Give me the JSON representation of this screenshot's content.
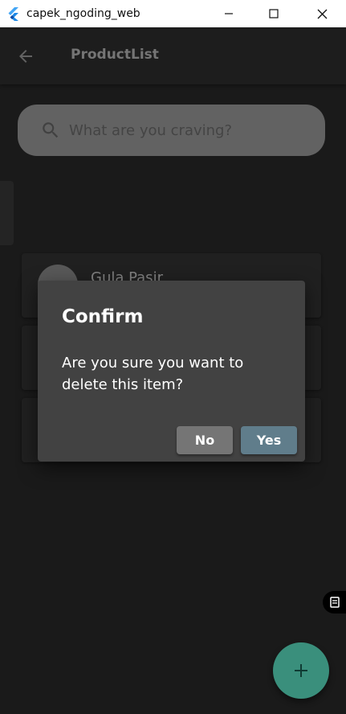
{
  "window": {
    "title": "capek_ngoding_web",
    "app_icon": "flutter-logo",
    "controls": [
      "minimize-icon",
      "maximize-icon",
      "close-icon"
    ]
  },
  "appbar": {
    "title": "ProductList",
    "back_icon": "arrow-back-icon"
  },
  "search": {
    "placeholder": "What are you craving?",
    "value": "",
    "icon": "search-icon"
  },
  "list": {
    "items": [
      {
        "name": "Gula Pasir"
      },
      {
        "name": ""
      },
      {
        "name": ""
      }
    ]
  },
  "dialog": {
    "title": "Confirm",
    "content": "Are you sure you want to delete this item?",
    "no_label": "No",
    "yes_label": "Yes"
  },
  "fab": {
    "icon": "add-icon"
  },
  "colors": {
    "background": "#2a2a2a",
    "appbar": "#303030",
    "search_bg": "#9e9e9e",
    "dialog_bg": "#424242",
    "no_button": "#757575",
    "yes_button": "#607d8b",
    "fab": "#3a8f7c"
  }
}
